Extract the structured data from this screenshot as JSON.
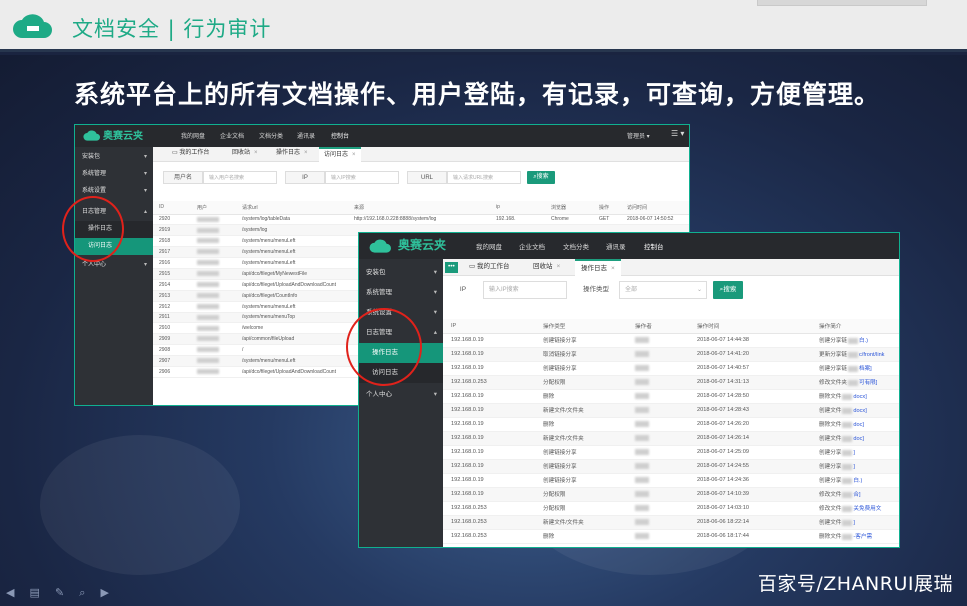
{
  "header": {
    "title": "文档安全 | 行为审计"
  },
  "headline": "系统平台上的所有文档操作、用户登陆，有记录，可查询，方便管理。",
  "watermark": "百家号/ZHANRUI展瑞",
  "colors": {
    "accent": "#1a9a7b",
    "highlight": "#e0221b",
    "nav_bg": "#27292d"
  },
  "win1": {
    "brand": "奥赛云夹",
    "nav": [
      "我的网盘",
      "企业文档",
      "文档分类",
      "通讯录",
      "控制台"
    ],
    "nav_active": "控制台",
    "user": "管理员 ▾",
    "sidebar": [
      {
        "label": "安装包",
        "caret": "▾"
      },
      {
        "label": "系统管理",
        "caret": "▾"
      },
      {
        "label": "系统设置",
        "caret": "▾"
      },
      {
        "label": "日志管理",
        "caret": "▴"
      },
      {
        "label": "操作日志",
        "caret": ""
      },
      {
        "label": "访问日志",
        "caret": ""
      },
      {
        "label": "个人中心",
        "caret": "▾"
      }
    ],
    "tabs": [
      "我的工作台",
      "回收站",
      "操作日志",
      "访问日志"
    ],
    "filters": {
      "user_label": "用户名",
      "user_placeholder": "输入用户名搜索",
      "ip_label": "IP",
      "ip_placeholder": "输入IP搜索",
      "url_label": "URL",
      "url_placeholder": "输入请求URL搜索",
      "search": "搜索"
    },
    "columns": [
      "ID",
      "用户",
      "请求url",
      "来源",
      "ip",
      "浏览器",
      "操作",
      "访问时间"
    ],
    "rows": [
      [
        "2920",
        "",
        "/system/log/tableData",
        "http://192.168.0.228:8888/system/log",
        "192.168.",
        "Chrome",
        "GET",
        "2018-06-07 14:50:52"
      ],
      [
        "2919",
        "",
        "/system/log",
        "",
        "",
        "",
        "",
        ""
      ],
      [
        "2918",
        "",
        "/system/menu/menuLeft",
        "",
        "",
        "",
        "",
        ""
      ],
      [
        "2917",
        "",
        "/system/menu/menuLeft",
        "",
        "",
        "",
        "",
        ""
      ],
      [
        "2916",
        "",
        "/system/menu/menuLeft",
        "",
        "",
        "",
        "",
        ""
      ],
      [
        "2915",
        "",
        "/api/dco/fileget/MyNewestFile",
        "",
        "",
        "",
        "",
        ""
      ],
      [
        "2914",
        "",
        "/api/dco/fileget/UploadAndDownloadCount",
        "",
        "",
        "",
        "",
        ""
      ],
      [
        "2913",
        "",
        "/api/dco/fileget/CountInfo",
        "",
        "",
        "",
        "",
        ""
      ],
      [
        "2912",
        "",
        "/system/menu/menuLeft",
        "",
        "",
        "",
        "",
        ""
      ],
      [
        "2911",
        "",
        "/system/menu/menuTop",
        "",
        "",
        "",
        "",
        ""
      ],
      [
        "2910",
        "",
        "/welcome",
        "",
        "",
        "",
        "",
        ""
      ],
      [
        "2909",
        "",
        "/api/common/fileUpload",
        "",
        "",
        "",
        "",
        ""
      ],
      [
        "2908",
        "",
        "/",
        "",
        "",
        "",
        "",
        ""
      ],
      [
        "2907",
        "",
        "/system/menu/menuLeft",
        "",
        "",
        "",
        "",
        ""
      ],
      [
        "2906",
        "",
        "/api/dco/fileget/UploadAndDownloadCount",
        "",
        "",
        "",
        "",
        ""
      ]
    ]
  },
  "win2": {
    "brand": "奥赛云夹",
    "nav": [
      "我的网盘",
      "企业文档",
      "文档分类",
      "通讯录",
      "控制台"
    ],
    "nav_active": "控制台",
    "sidebar": [
      {
        "label": "安装包",
        "caret": "▾"
      },
      {
        "label": "系统管理",
        "caret": "▾"
      },
      {
        "label": "系统设置",
        "caret": "▾"
      },
      {
        "label": "日志管理",
        "caret": "▴"
      },
      {
        "label": "操作日志",
        "caret": ""
      },
      {
        "label": "访问日志",
        "caret": ""
      },
      {
        "label": "个人中心",
        "caret": "▾"
      }
    ],
    "tabs": [
      "我的工作台",
      "回收站",
      "操作日志"
    ],
    "filters": {
      "ip_label": "IP",
      "ip_placeholder": "输入IP搜索",
      "type_label": "操作类型",
      "type_value": "全部",
      "search": "搜索"
    },
    "columns": [
      "IP",
      "操作类型",
      "操作者",
      "操作时间",
      "操作简介"
    ],
    "rows": [
      [
        "192.168.0.19",
        "创建链接分享",
        "2018-06-07 14:44:38",
        "创建分享链",
        "白.)"
      ],
      [
        "192.168.0.19",
        "取消链接分享",
        "2018-06-07 14:41:20",
        "更新分享链",
        "c/front/link"
      ],
      [
        "192.168.0.19",
        "创建链接分享",
        "2018-06-07 14:40:57",
        "创建分享链",
        "档案]"
      ],
      [
        "192.168.0.253",
        "分配权限",
        "2018-06-07 14:31:13",
        "修改文件夹",
        "可有限]"
      ],
      [
        "192.168.0.19",
        "删除",
        "2018-06-07 14:28:50",
        "删除文件",
        "docx]"
      ],
      [
        "192.168.0.19",
        "新建文件/文件夹",
        "2018-06-07 14:28:43",
        "创建文件",
        "docx]"
      ],
      [
        "192.168.0.19",
        "删除",
        "2018-06-07 14:26:20",
        "删除文件",
        "doc]"
      ],
      [
        "192.168.0.19",
        "新建文件/文件夹",
        "2018-06-07 14:26:14",
        "创建文件",
        "doc]"
      ],
      [
        "192.168.0.19",
        "创建链接分享",
        "2018-06-07 14:25:09",
        "创建分享",
        "]"
      ],
      [
        "192.168.0.19",
        "创建链接分享",
        "2018-06-07 14:24:55",
        "创建分享",
        "]"
      ],
      [
        "192.168.0.19",
        "创建链接分享",
        "2018-06-07 14:24:36",
        "创建分享",
        "白.)"
      ],
      [
        "192.168.0.19",
        "分配权限",
        "2018-06-07 14:10:39",
        "修改文件",
        "合]"
      ],
      [
        "192.168.0.253",
        "分配权限",
        "2018-06-07 14:03:10",
        "修改文件",
        "关免费用文"
      ],
      [
        "192.168.0.253",
        "新建文件/文件夹",
        "2018-06-06 18:22:14",
        "创建文件",
        "]"
      ],
      [
        "192.168.0.253",
        "删除",
        "2018-06-06 18:17:44",
        "删除文件",
        "-客户需"
      ]
    ]
  }
}
